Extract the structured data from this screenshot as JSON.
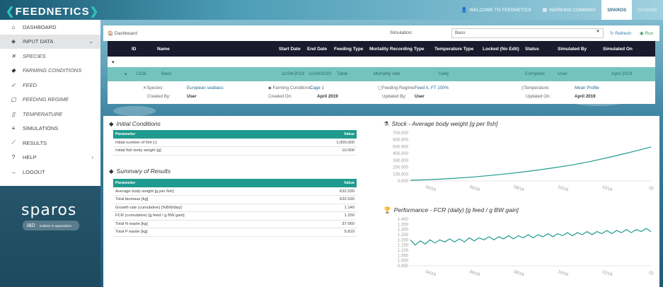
{
  "app": {
    "logo_main": "FEEDNETICS"
  },
  "topbar": {
    "welcome": "WELCOME TO FEEDNETICS",
    "company": "WORKING COMPANY",
    "org": "SPAROS",
    "change": "CHANGE"
  },
  "sidebar": {
    "items": [
      {
        "label": "DASHBOARD",
        "icon": "home-icon",
        "glyph": "⌂"
      },
      {
        "label": "INPUT DATA",
        "icon": "input-data-icon",
        "glyph": "◈"
      },
      {
        "label": "SPECIES",
        "icon": "fish-skeleton-icon",
        "glyph": "✕"
      },
      {
        "label": "FARMING CONDITIONS",
        "icon": "fish-icon",
        "glyph": "◆"
      },
      {
        "label": "FEED",
        "icon": "feed-icon",
        "glyph": "✓"
      },
      {
        "label": "FEEDING REGIME",
        "icon": "clipboard-icon",
        "glyph": "▢"
      },
      {
        "label": "TEMPERATURE",
        "icon": "thermometer-icon",
        "glyph": "▯"
      },
      {
        "label": "SIMULATIONS",
        "icon": "list-icon",
        "glyph": "≡"
      },
      {
        "label": "RESULTS",
        "icon": "chart-icon",
        "glyph": "⟋"
      },
      {
        "label": "HELP",
        "icon": "help-icon",
        "glyph": "?"
      },
      {
        "label": "LOGOUT",
        "icon": "logout-icon",
        "glyph": "→"
      }
    ]
  },
  "brand": {
    "name": "sparos",
    "badge": "I&D",
    "badge_sub": "nutrition in aquaculture"
  },
  "toolbar": {
    "breadcrumb": "Dashboard",
    "simulation_label": "Simulation:",
    "simulation_value": "Bass",
    "refresh": "Refresh",
    "run": "Run"
  },
  "grid": {
    "headers": [
      "ID",
      "Name",
      "Start Date",
      "End Date",
      "Feeding Type",
      "Mortality Recording Type",
      "Temperature Type",
      "Locked (No Edit)",
      "Status",
      "Simulated By",
      "Simulated On"
    ],
    "row": [
      "1328",
      "Bass",
      "11/04/2019",
      "11/04/2020",
      "Table",
      "Mortality rate",
      "Daily",
      "",
      "Complete",
      "User",
      "April 2019"
    ]
  },
  "detail": {
    "species_label": "Species:",
    "species_value": "European seabass",
    "farming_label": "Farming Conditions:",
    "farming_value": "Cage 1",
    "feeding_label": "Feeding Regime:",
    "feeding_value": "Feed A, FT 100%",
    "temp_label": "Temperature:",
    "temp_value": "Mean Profile",
    "created_by_label": "Created By:",
    "created_by_value": "User",
    "created_on_label": "Created On:",
    "created_on_value": "April 2019",
    "updated_by_label": "Updated By:",
    "updated_by_value": "User",
    "updated_on_label": "Updated On:",
    "updated_on_value": "April 2019"
  },
  "initial_conditions": {
    "title": "Initial Conditions",
    "col_param": "Parameter",
    "col_value": "Value",
    "rows": [
      {
        "param": "Initial number of fish [-]",
        "value": "1,000,000"
      },
      {
        "param": "Initial fish body weight [g]",
        "value": "10.000"
      }
    ]
  },
  "summary": {
    "title": "Summary of Results",
    "col_param": "Parameter",
    "col_value": "Value",
    "rows": [
      {
        "param": "Average body weight [g per fish]",
        "value": "632.530"
      },
      {
        "param": "Total biomass [kg]",
        "value": "632.530"
      },
      {
        "param": "Growth rate (cumulative) [%BW/day]",
        "value": "1.140"
      },
      {
        "param": "FCR (cumulative) [g feed / g BW gain]",
        "value": "1.250"
      },
      {
        "param": "Total N waste [kg]",
        "value": "37.060"
      },
      {
        "param": "Total P waste [kg]",
        "value": "5.810"
      }
    ]
  },
  "chart_data": [
    {
      "type": "line",
      "title": "Stock - Average body weight [g per fish]",
      "yticks": [
        "700.000",
        "600.000",
        "500.000",
        "400.000",
        "300.000",
        "200.000",
        "100.000",
        "0.000"
      ],
      "ylim": [
        0,
        700
      ],
      "xticks": [
        "04/19",
        "06/19",
        "08/19",
        "10/19",
        "12/19",
        "02"
      ],
      "x": [
        0,
        1,
        2,
        3,
        4,
        5,
        6,
        7,
        8,
        9,
        10,
        11,
        12
      ],
      "values": [
        10,
        20,
        35,
        55,
        80,
        110,
        145,
        185,
        230,
        285,
        350,
        420,
        495
      ],
      "color": "#1f9a8e"
    },
    {
      "type": "line",
      "title": "Performance - FCR (daily) [g feed / g BW gain]",
      "yticks": [
        "1.400",
        "1.350",
        "1.300",
        "1.250",
        "1.200",
        "1.150",
        "1.100",
        "1.050",
        "1.000",
        "0.950"
      ],
      "ylim": [
        0.95,
        1.4
      ],
      "xticks": [
        "04/19",
        "06/19",
        "08/19",
        "10/19",
        "12/19",
        "02"
      ],
      "values": [
        1.2,
        1.15,
        1.19,
        1.16,
        1.2,
        1.17,
        1.2,
        1.18,
        1.21,
        1.18,
        1.21,
        1.18,
        1.22,
        1.19,
        1.22,
        1.2,
        1.23,
        1.2,
        1.23,
        1.21,
        1.24,
        1.21,
        1.24,
        1.22,
        1.25,
        1.22,
        1.25,
        1.23,
        1.26,
        1.23,
        1.26,
        1.24,
        1.27,
        1.24,
        1.27,
        1.25,
        1.28,
        1.25,
        1.28,
        1.26,
        1.29,
        1.26,
        1.29,
        1.27,
        1.3,
        1.27,
        1.3,
        1.28,
        1.31,
        1.28
      ],
      "color": "#1f9a8e"
    }
  ]
}
